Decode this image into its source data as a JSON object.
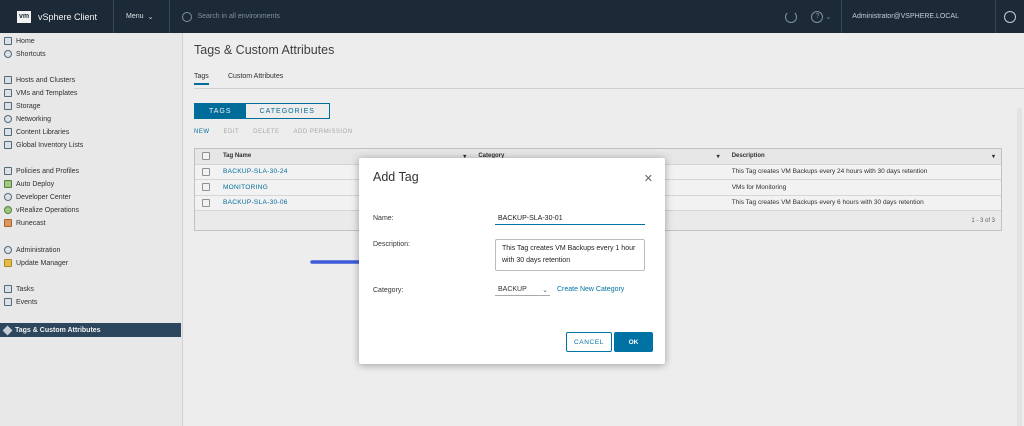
{
  "header": {
    "logo": "vm",
    "app_title": "vSphere Client",
    "menu_label": "Menu",
    "search_placeholder": "Search in all environments",
    "user": "Administrator@VSPHERE.LOCAL"
  },
  "sidebar": {
    "items": [
      {
        "label": "Home",
        "icon": "home-icon"
      },
      {
        "label": "Shortcuts",
        "icon": "shortcuts-icon"
      },
      {
        "label": "Hosts and Clusters",
        "icon": "hosts-icon"
      },
      {
        "label": "VMs and Templates",
        "icon": "vms-icon"
      },
      {
        "label": "Storage",
        "icon": "storage-icon"
      },
      {
        "label": "Networking",
        "icon": "network-icon"
      },
      {
        "label": "Content Libraries",
        "icon": "library-icon"
      },
      {
        "label": "Global Inventory Lists",
        "icon": "list-icon"
      },
      {
        "label": "Policies and Profiles",
        "icon": "policy-icon"
      },
      {
        "label": "Auto Deploy",
        "icon": "deploy-icon"
      },
      {
        "label": "Developer Center",
        "icon": "dev-icon"
      },
      {
        "label": "vRealize Operations",
        "icon": "vrops-icon"
      },
      {
        "label": "Runecast",
        "icon": "runecast-icon"
      },
      {
        "label": "Administration",
        "icon": "admin-icon"
      },
      {
        "label": "Update Manager",
        "icon": "update-icon"
      },
      {
        "label": "Tasks",
        "icon": "tasks-icon"
      },
      {
        "label": "Events",
        "icon": "events-icon"
      }
    ],
    "selected": "Tags & Custom Attributes"
  },
  "main": {
    "title": "Tags & Custom Attributes",
    "subtabs": [
      "Tags",
      "Custom Attributes"
    ],
    "segments": [
      "TAGS",
      "CATEGORIES"
    ],
    "actions": [
      "NEW",
      "EDIT",
      "DELETE",
      "ADD PERMISSION"
    ],
    "grid": {
      "headers": [
        "Tag Name",
        "Category",
        "Description"
      ],
      "rows": [
        {
          "name": "BACKUP-SLA-30-24",
          "desc": "This Tag creates VM Backups every 24 hours with 30 days retention"
        },
        {
          "name": "MONITORING",
          "desc": "VMs for Monitoring"
        },
        {
          "name": "BACKUP-SLA-30-06",
          "desc": "This Tag creates VM Backups every 6 hours with 30 days retention"
        }
      ],
      "footer": "1 - 3 of 3"
    }
  },
  "dialog": {
    "title": "Add Tag",
    "name_label": "Name:",
    "name_value": "BACKUP-SLA-30-01",
    "description_label": "Description:",
    "description_value": "This Tag creates VM Backups every 1 hour with 30 days retention",
    "category_label": "Category:",
    "category_value": "BACKUP",
    "create_category": "Create New Category",
    "cancel": "CANCEL",
    "ok": "OK"
  },
  "colors": {
    "header_bg": "#1e2d3c",
    "accent": "#0072a3",
    "arrow": "#3d5bd9"
  }
}
